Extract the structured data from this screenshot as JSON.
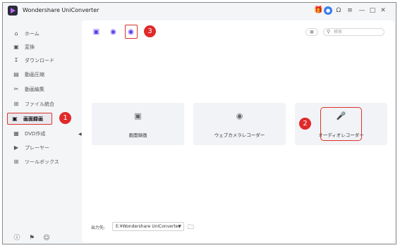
{
  "app": {
    "title": "Wondershare UniConverter"
  },
  "sidebar": {
    "items": [
      {
        "label": "ホーム",
        "icon": "home-icon"
      },
      {
        "label": "変換",
        "icon": "convert-icon"
      },
      {
        "label": "ダウンロード",
        "icon": "download-icon"
      },
      {
        "label": "動画圧縮",
        "icon": "compress-icon"
      },
      {
        "label": "動画編集",
        "icon": "scissors-icon"
      },
      {
        "label": "ファイル統合",
        "icon": "merge-icon"
      },
      {
        "label": "画面録画",
        "icon": "screen-record-icon",
        "active": true
      },
      {
        "label": "DVD作成",
        "icon": "dvd-icon"
      },
      {
        "label": "プレーヤー",
        "icon": "player-icon"
      },
      {
        "label": "ツールボックス",
        "icon": "toolbox-icon"
      }
    ]
  },
  "search": {
    "placeholder": "検索"
  },
  "cards": [
    {
      "label": "画面録画",
      "icon": "screen-record-icon"
    },
    {
      "label": "ウェブカメラレコーダー",
      "icon": "webcam-icon"
    },
    {
      "label": "オーディオレコーダー",
      "icon": "microphone-icon"
    }
  ],
  "footer": {
    "output_label": "出力先:",
    "output_path": "E:¥Wondershare UniConverter"
  },
  "annotations": {
    "badge1": "1",
    "badge2": "2",
    "badge3": "3"
  },
  "colors": {
    "accent": "#5a3df0",
    "highlight": "#d9342b",
    "badge": "#e02a2a"
  }
}
